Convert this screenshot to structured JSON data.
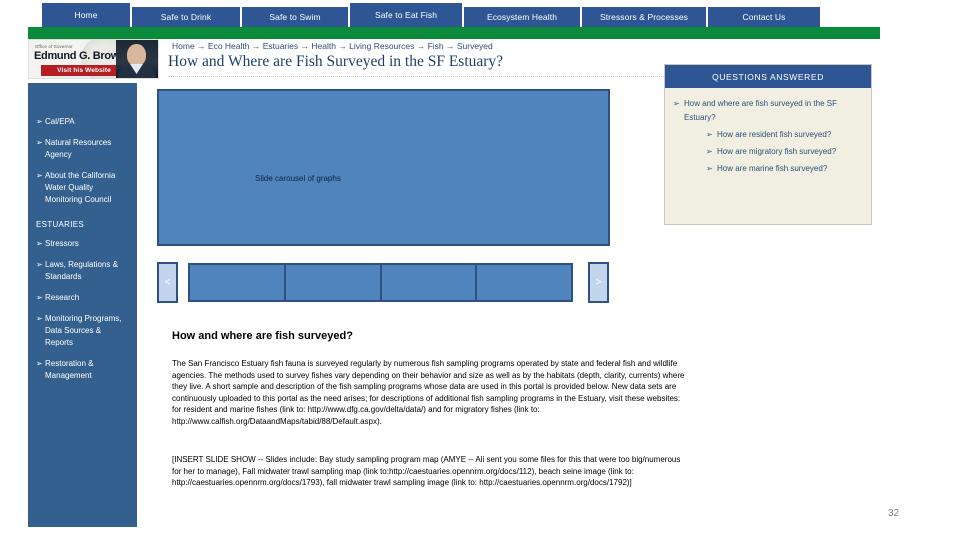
{
  "nav": {
    "tabs": [
      {
        "label": "Home",
        "key": "home"
      },
      {
        "label": "Safe to Drink",
        "key": "drink"
      },
      {
        "label": "Safe to Swim",
        "key": "swim"
      },
      {
        "label": "Safe to Eat Fish",
        "key": "eatfish"
      },
      {
        "label": "Ecosystem Health",
        "key": "eco"
      },
      {
        "label": "Stressors & Processes",
        "key": "stress"
      },
      {
        "label": "Contact Us",
        "key": "contact"
      }
    ]
  },
  "colors": {
    "nav_blue": "#2e5694",
    "green_bar": "#0b8a3c",
    "sidebar_blue": "#33608f",
    "carousel_blue": "#5084bd",
    "panel_border": "#2e5180",
    "qa_cream": "#f1efe2",
    "title_blue": "#1f3f6b",
    "banner_red": "#b41f24"
  },
  "governor_banner": {
    "office_label": "Office of Governor",
    "name": "Edmund G. Brown Jr.",
    "cta": "Visit his Website"
  },
  "breadcrumb": {
    "text": "Home → Eco Health → Estuaries → Health → Living Resources → Fish → Surveyed"
  },
  "page_title": "How and Where are Fish Surveyed in the SF Estuary?",
  "sidebar": {
    "items": [
      {
        "label": "Cal/EPA",
        "bullet": "➢"
      },
      {
        "label": "Natural Resources Agency",
        "bullet": "➢"
      },
      {
        "label": "About the California Water Quality Monitoring Council",
        "bullet": "➢"
      }
    ],
    "section_heading": "ESTUARIES",
    "section_items": [
      {
        "label": "Stressors",
        "bullet": "➢"
      },
      {
        "label": "Laws, Regulations & Standards",
        "bullet": "➢"
      },
      {
        "label": "Research",
        "bullet": "➢"
      },
      {
        "label": "Monitoring Programs, Data Sources & Reports",
        "bullet": "➢"
      },
      {
        "label": "Restoration & Management",
        "bullet": "➢"
      }
    ]
  },
  "questions_answered": {
    "header": "QUESTIONS ANSWERED",
    "bullet": "➢",
    "primary": "How and where are fish surveyed in the SF Estuary?",
    "sub_items": [
      "How are resident fish surveyed?",
      "How are migratory fish surveyed?",
      "How are marine fish surveyed?"
    ]
  },
  "carousel": {
    "caption": "Slide carousel of graphs",
    "prev_label": "<",
    "next_label": ">",
    "thumbnail_count": 4
  },
  "article": {
    "heading": "How and where are fish surveyed?",
    "paragraph1": "The San Francisco Estuary fish fauna is surveyed regularly by numerous fish sampling programs operated by state and federal fish and wildlife agencies.  The methods used to survey fishes vary depending on their behavior and size as well as by the habitats (depth, clarity, currents) where they live.  A short sample and description of the fish sampling programs whose data are used in this portal is provided below. New data sets are continuously uploaded to this portal as the need arises; for descriptions of additional fish sampling programs in the Estuary, visit these websites: for resident and marine fishes (link to: http://www.dfg.ca.gov/delta/data/) and for migratory fishes (link to: http://www.calfish.org/DataandMaps/tabid/88/Default.aspx).",
    "paragraph2": "[INSERT SLIDE SHOW -- Slides include: Bay study sampling program map (AMYE -- Ali sent you some files for this that were too big/numerous for her to manage), Fall midwater trawl sampling map (link to:http://caestuaries.opennrm.org/docs/112), beach seine image (link to: http://caestuaries.opennrm.org/docs/1793), fall midwater trawl sampling image (link to: http://caestuaries.opennrm.org/docs/1792)]"
  },
  "page_number": "32"
}
